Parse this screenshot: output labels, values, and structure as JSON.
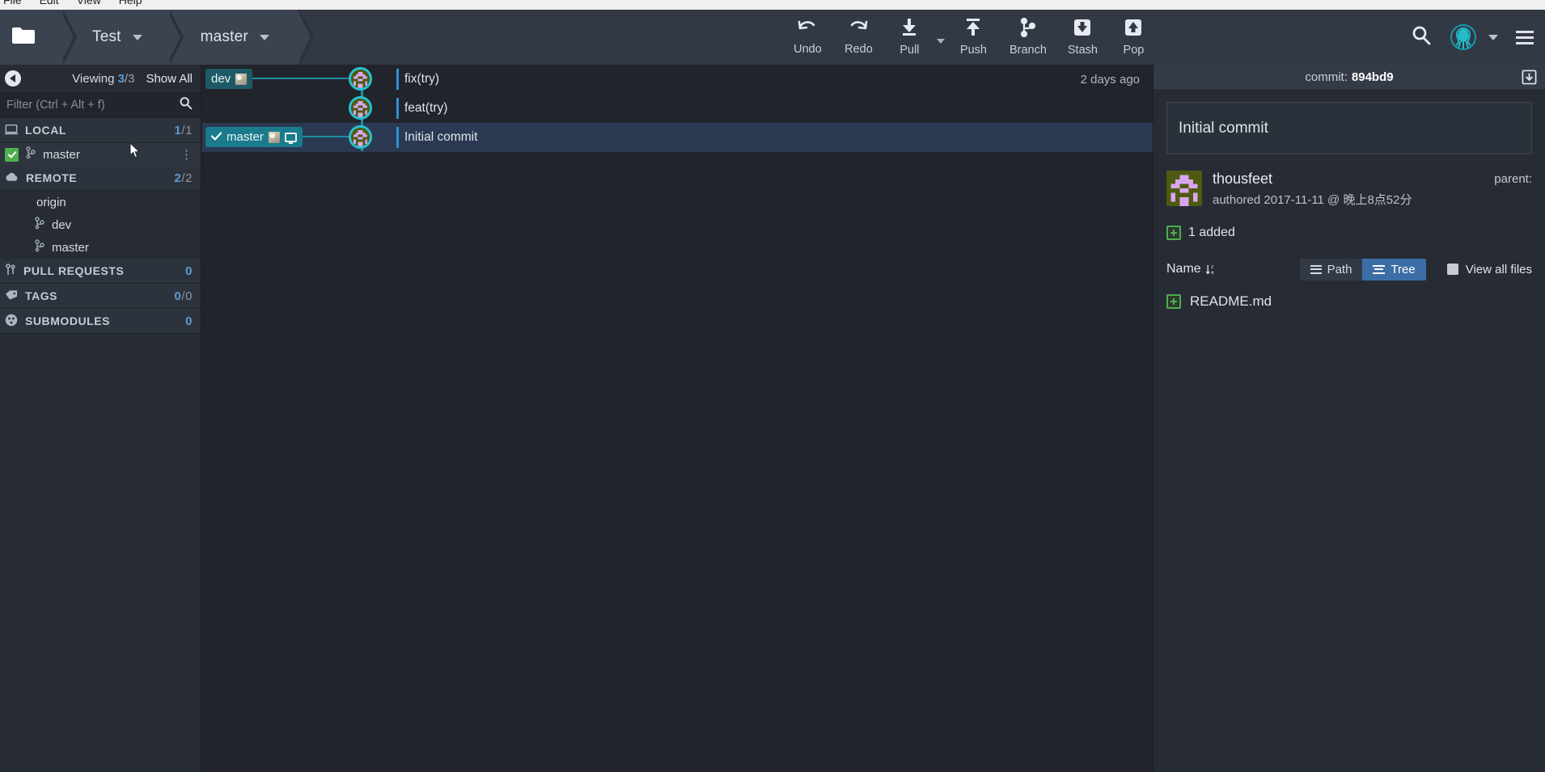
{
  "menubar": {
    "items": [
      "File",
      "Edit",
      "View",
      "Help"
    ]
  },
  "toolbar": {
    "folder_icon": "folder-icon",
    "repo_name": "Test",
    "branch_name": "master",
    "actions": [
      {
        "label": "Undo",
        "icon": "undo-icon"
      },
      {
        "label": "Redo",
        "icon": "redo-icon"
      },
      {
        "label": "Pull",
        "icon": "pull-icon"
      },
      {
        "label": "Push",
        "icon": "push-icon"
      },
      {
        "label": "Branch",
        "icon": "branch-icon"
      },
      {
        "label": "Stash",
        "icon": "stash-icon"
      },
      {
        "label": "Pop",
        "icon": "pop-icon"
      }
    ],
    "search_icon": "search-icon",
    "logo_icon": "gitkraken-logo-icon",
    "menu_icon": "hamburger-menu-icon"
  },
  "sidebar": {
    "collapse_icon": "collapse-left-icon",
    "viewing_label": "Viewing",
    "viewing_current": "3",
    "viewing_total": "3",
    "show_all_label": "Show All",
    "filter_placeholder": "Filter (Ctrl + Alt + f)",
    "filter_value": "",
    "search_icon": "search-icon",
    "sections": [
      {
        "name": "local",
        "label": "LOCAL",
        "icon": "laptop-icon",
        "count": "1",
        "count_total": "1",
        "items": [
          {
            "label": "master",
            "icon": "branch-icon",
            "checked": true,
            "kebab": "⋮"
          }
        ]
      },
      {
        "name": "remote",
        "label": "REMOTE",
        "icon": "cloud-icon",
        "count": "2",
        "count_total": "2",
        "items": [
          {
            "label": "origin",
            "icon": "remote-avatar-icon",
            "level": 1
          },
          {
            "label": "dev",
            "icon": "branch-icon",
            "level": 2
          },
          {
            "label": "master",
            "icon": "branch-icon",
            "level": 2
          }
        ]
      },
      {
        "name": "pull-requests",
        "label": "PULL REQUESTS",
        "icon": "pull-request-icon",
        "count": "0",
        "count_total": "",
        "items": []
      },
      {
        "name": "tags",
        "label": "TAGS",
        "icon": "tag-icon",
        "count": "0",
        "count_total": "0",
        "items": []
      },
      {
        "name": "submodules",
        "label": "SUBMODULES",
        "icon": "submodule-icon",
        "count": "0",
        "count_total": "",
        "items": []
      }
    ]
  },
  "graph": {
    "rows": [
      {
        "message": "fix(try)",
        "ref": "dev",
        "ref_type": "remote",
        "time": "2 days ago",
        "selected": false
      },
      {
        "message": "feat(try)",
        "ref": "",
        "ref_type": "",
        "time": "",
        "selected": false
      },
      {
        "message": "Initial commit",
        "ref": "master",
        "ref_type": "local",
        "time": "",
        "selected": true
      }
    ]
  },
  "commit_panel": {
    "header_label": "commit:",
    "header_sha": "894bd9",
    "save_icon": "save-patch-icon",
    "message": "Initial commit",
    "author_name": "thousfeet",
    "authored_line": "authored 2017-11-11 @ 晚上8点52分",
    "parent_label": "parent:",
    "added_label": "1 added",
    "name_column": "Name",
    "sort_glyph": "sort-az-icon",
    "path_label": "Path",
    "tree_label": "Tree",
    "active_view": "Tree",
    "view_all_label": "View all files",
    "files": [
      {
        "name": "README.md",
        "status": "added"
      }
    ]
  },
  "colors": {
    "accent_blue": "#5b9bd5",
    "graph_teal": "#27c1d4",
    "ref_chip": "#1a7b8c",
    "added_green": "#4caf50",
    "selected_row": "#2b3a52"
  }
}
